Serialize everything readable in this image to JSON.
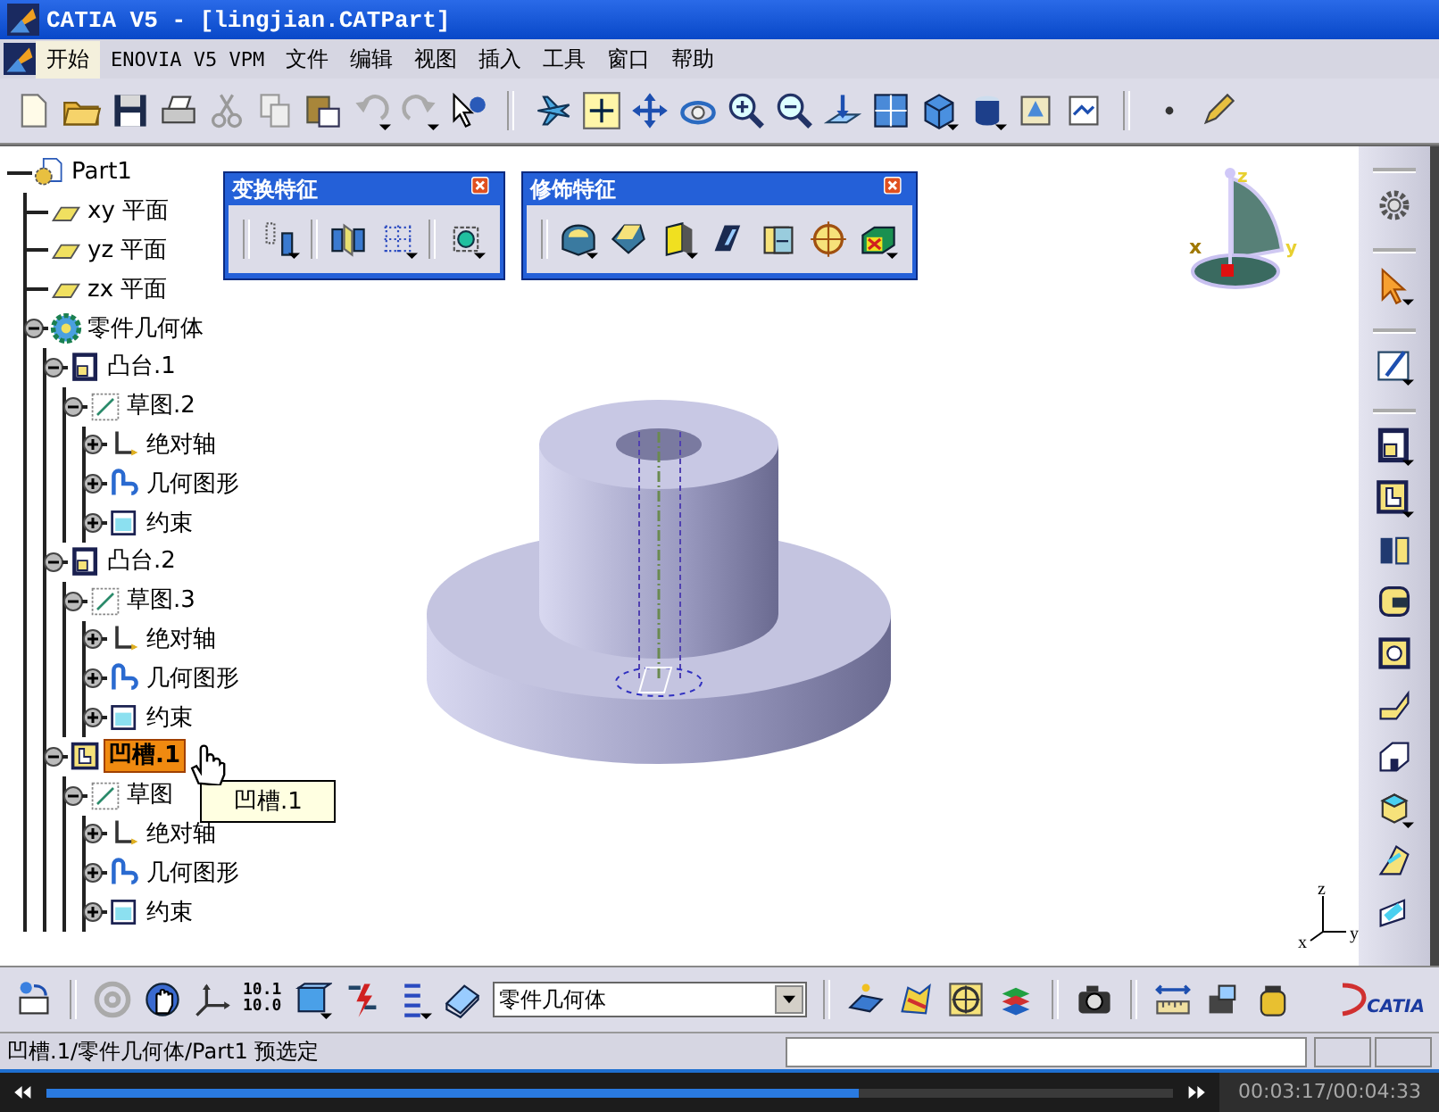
{
  "window": {
    "title": "CATIA V5 - [lingjian.CATPart]"
  },
  "menu": [
    {
      "label": "开始",
      "selected": true
    },
    {
      "label": "ENOVIA V5 VPM",
      "selected": false
    },
    {
      "label": "文件",
      "selected": false
    },
    {
      "label": "编辑",
      "selected": false
    },
    {
      "label": "视图",
      "selected": false
    },
    {
      "label": "插入",
      "selected": false
    },
    {
      "label": "工具",
      "selected": false
    },
    {
      "label": "窗口",
      "selected": false
    },
    {
      "label": "帮助",
      "selected": false
    }
  ],
  "tree": {
    "label": "Part1",
    "kind": "part",
    "selected": false,
    "children": [
      {
        "label": "xy 平面",
        "kind": "plane",
        "selected": false
      },
      {
        "label": "yz 平面",
        "kind": "plane",
        "selected": false
      },
      {
        "label": "zx 平面",
        "kind": "plane",
        "selected": false
      },
      {
        "label": "零件几何体",
        "kind": "body",
        "expanded": true,
        "selected": false,
        "children": [
          {
            "label": "凸台.1",
            "kind": "pad",
            "expanded": true,
            "selected": false,
            "children": [
              {
                "label": "草图.2",
                "kind": "sketch",
                "expanded": true,
                "selected": false,
                "children": [
                  {
                    "label": "绝对轴",
                    "kind": "axis",
                    "expanded": false,
                    "selected": false
                  },
                  {
                    "label": "几何图形",
                    "kind": "geometry",
                    "expanded": false,
                    "selected": false
                  },
                  {
                    "label": "约束",
                    "kind": "constraint",
                    "expanded": false,
                    "selected": false
                  }
                ]
              }
            ]
          },
          {
            "label": "凸台.2",
            "kind": "pad",
            "expanded": true,
            "selected": false,
            "children": [
              {
                "label": "草图.3",
                "kind": "sketch",
                "expanded": true,
                "selected": false,
                "children": [
                  {
                    "label": "绝对轴",
                    "kind": "axis",
                    "expanded": false,
                    "selected": false
                  },
                  {
                    "label": "几何图形",
                    "kind": "geometry",
                    "expanded": false,
                    "selected": false
                  },
                  {
                    "label": "约束",
                    "kind": "constraint",
                    "expanded": false,
                    "selected": false
                  }
                ]
              }
            ]
          },
          {
            "label": "凹槽.1",
            "kind": "pocket",
            "expanded": true,
            "selected": true,
            "children": [
              {
                "label": "草图",
                "kind": "sketch",
                "expanded": true,
                "selected": false,
                "children": [
                  {
                    "label": "绝对轴",
                    "kind": "axis",
                    "expanded": false,
                    "selected": false
                  },
                  {
                    "label": "几何图形",
                    "kind": "geometry",
                    "expanded": false,
                    "selected": false
                  },
                  {
                    "label": "约束",
                    "kind": "constraint",
                    "expanded": false,
                    "selected": false
                  }
                ]
              }
            ]
          }
        ]
      }
    ]
  },
  "tooltip": {
    "text": "凹槽.1"
  },
  "floating_toolbars": [
    {
      "title": "变换特征",
      "kind": "transformation"
    },
    {
      "title": "修饰特征",
      "kind": "dress-up"
    }
  ],
  "compass": {
    "labels": [
      "z",
      "y",
      "x"
    ]
  },
  "axis_triad": {
    "labels": [
      "z",
      "x",
      "y"
    ]
  },
  "bottom_toolbar": {
    "number_format": [
      "10.1",
      "10.0"
    ],
    "body_dropdown": {
      "value": "零件几何体"
    },
    "logo": "CATIA"
  },
  "status_bar": {
    "text": "凹槽.1/零件几何体/Part1 预选定"
  },
  "player": {
    "level": 0.72,
    "time": "00:03:17/00:04:33"
  }
}
